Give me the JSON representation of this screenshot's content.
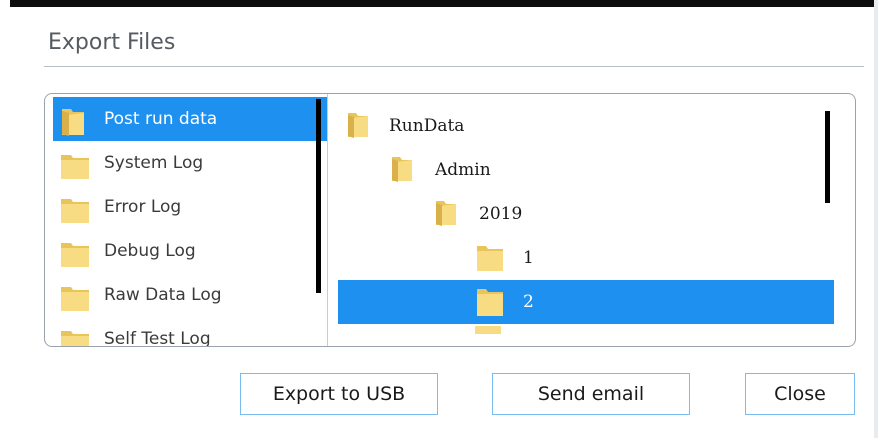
{
  "dialog": {
    "title": "Export Files"
  },
  "log_types": [
    {
      "label": "Post run data",
      "selected": true
    },
    {
      "label": "System Log",
      "selected": false
    },
    {
      "label": "Error Log",
      "selected": false
    },
    {
      "label": "Debug Log",
      "selected": false
    },
    {
      "label": "Raw Data Log",
      "selected": false
    },
    {
      "label": "Self Test Log",
      "selected": false
    }
  ],
  "folder_tree": [
    {
      "label": "RunData",
      "level": 0,
      "selected": false
    },
    {
      "label": "Admin",
      "level": 1,
      "selected": false
    },
    {
      "label": "2019",
      "level": 2,
      "selected": false
    },
    {
      "label": "1",
      "level": 3,
      "selected": false
    },
    {
      "label": "2",
      "level": 3,
      "selected": true
    }
  ],
  "buttons": {
    "export_usb": "Export to USB",
    "send_email": "Send email",
    "close": "Close"
  },
  "icons": {
    "folder": "folder-icon"
  },
  "colors": {
    "selection": "#1e90f0",
    "folder": "#f5d77a",
    "button_border": "#79bdf0"
  }
}
